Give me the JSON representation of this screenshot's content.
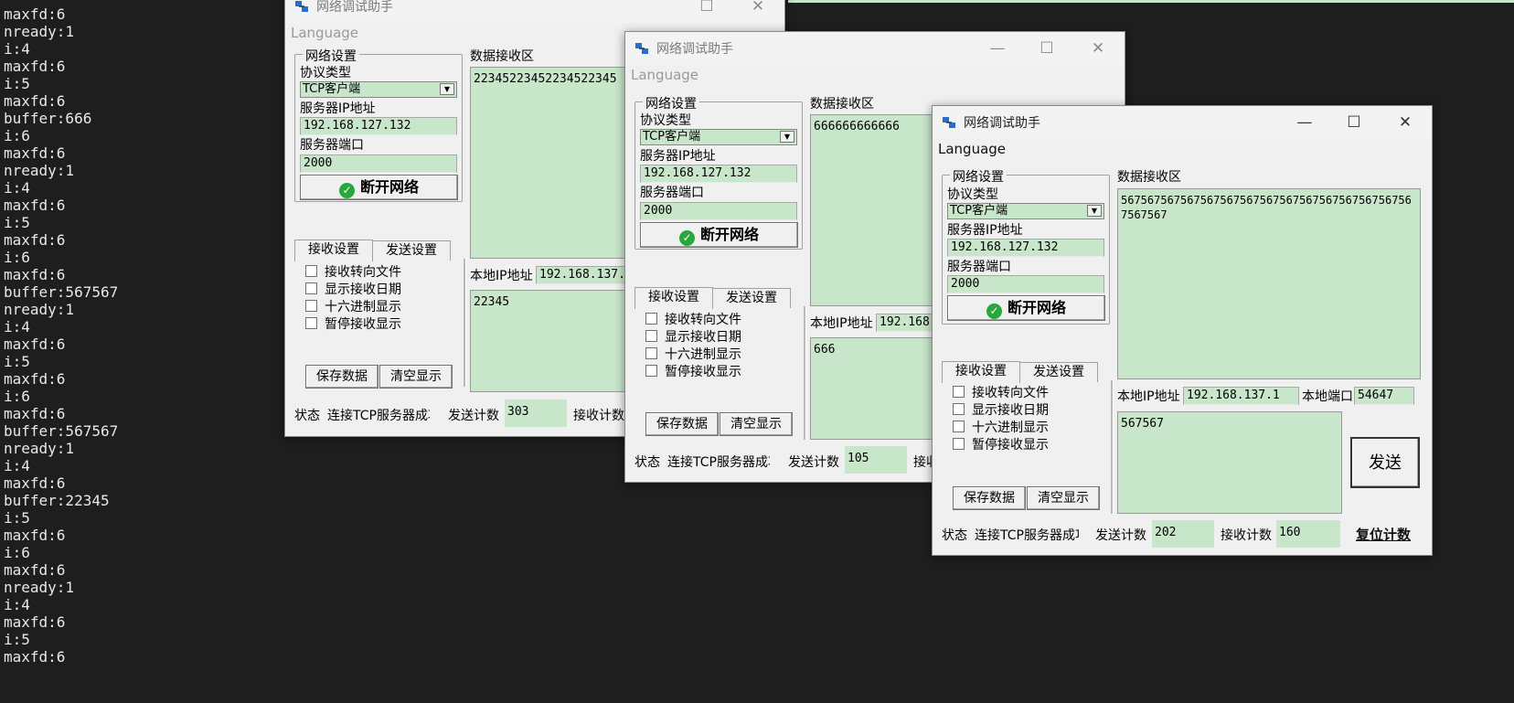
{
  "terminal": {
    "lines": [
      "maxfd:6",
      "nready:1",
      "i:4",
      "maxfd:6",
      "i:5",
      "maxfd:6",
      "buffer:666",
      "i:6",
      "maxfd:6",
      "nready:1",
      "i:4",
      "maxfd:6",
      "i:5",
      "maxfd:6",
      "i:6",
      "maxfd:6",
      "buffer:567567",
      "nready:1",
      "i:4",
      "maxfd:6",
      "i:5",
      "maxfd:6",
      "i:6",
      "maxfd:6",
      "buffer:567567",
      "nready:1",
      "i:4",
      "maxfd:6",
      "buffer:22345",
      "i:5",
      "maxfd:6",
      "i:6",
      "maxfd:6",
      "nready:1",
      "i:4",
      "maxfd:6",
      "i:5",
      "maxfd:6"
    ]
  },
  "common": {
    "title": "网络调试助手",
    "menu_language": "Language",
    "net_settings": "网络设置",
    "protocol_type": "协议类型",
    "protocol_value": "TCP客户端",
    "server_ip_label": "服务器IP地址",
    "server_ip": "192.168.127.132",
    "server_port_label": "服务器端口",
    "server_port": "2000",
    "disconnect": "断开网络",
    "recv_area_label": "数据接收区",
    "tab_recv": "接收设置",
    "tab_send": "发送设置",
    "opt1": "接收转向文件",
    "opt2": "显示接收日期",
    "opt3": "十六进制显示",
    "opt4": "暂停接收显示",
    "save_data": "保存数据",
    "clear_display": "清空显示",
    "local_ip_label": "本地IP地址",
    "status_label": "状态",
    "status_text": "连接TCP服务器成功",
    "send_count_label": "发送计数",
    "recv_count_label": "接收计数",
    "local_port_label": "本地端口",
    "send_button": "发送",
    "reset_count": "复位计数"
  },
  "windows": [
    {
      "recv_data": "22345223452234522345",
      "local_ip_partial": "192.168.137.1",
      "send_text": "22345",
      "send_count": "303"
    },
    {
      "recv_data": "666666666666",
      "local_ip_partial": "192.168.",
      "send_text": "666",
      "send_count": "105"
    },
    {
      "recv_data": "567567567567567567567567567567567567567567567567567",
      "local_ip": "192.168.137.1",
      "local_port": "54647",
      "send_text": "567567",
      "send_count": "202",
      "recv_count": "160"
    }
  ],
  "colors": {
    "field_bg": "#c8e6c9",
    "terminal_bg": "#1e1e1e",
    "window_bg": "#f0f0f0"
  }
}
